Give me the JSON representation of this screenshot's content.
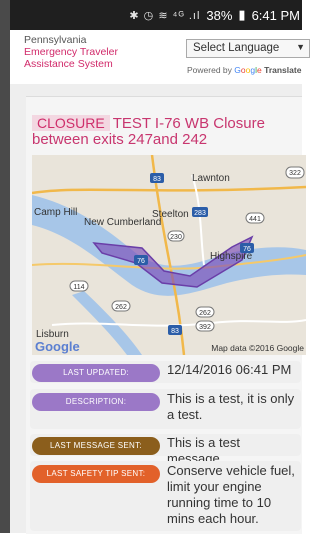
{
  "statusbar": {
    "icons": "✱ ◷ ≋ ⁴ᴳ .ıl",
    "battery": "38%",
    "battery_icon": "▮",
    "time": "6:41 PM"
  },
  "brand": {
    "line1": "Pennsylvania",
    "line2": "Emergency Traveler",
    "line3": "Assistance System"
  },
  "language": {
    "selected": "Select Language",
    "powered_by": "Powered by",
    "google": "Google",
    "translate": "Translate"
  },
  "alert": {
    "badge": "CLOSURE",
    "title": "TEST I-76 WB Closure between exits 247and 242"
  },
  "map": {
    "places": [
      "Lawnton",
      "Camp Hill",
      "New Cumberland",
      "Steelton",
      "Highspire",
      "Lisburn"
    ],
    "shields": [
      "83",
      "322",
      "283",
      "441",
      "230",
      "76",
      "114",
      "262",
      "262",
      "392",
      "83",
      "76"
    ],
    "logo": "Google",
    "attribution": "Map data ©2016 Google"
  },
  "details": [
    {
      "label": "LAST UPDATED:",
      "value": "12/14/2016 06:41 PM",
      "color": "#9b78c7"
    },
    {
      "label": "DESCRIPTION:",
      "value": "This is a test, it is only a test.",
      "color": "#9b78c7"
    },
    {
      "label": "LAST MESSAGE SENT:",
      "value": "This is a test message.",
      "color": "#8b5e1c"
    },
    {
      "label": "LAST SAFETY TIP SENT:",
      "value": "Conserve vehicle fuel, limit your engine running time to 10 mins each hour.",
      "color": "#e2612a"
    }
  ]
}
